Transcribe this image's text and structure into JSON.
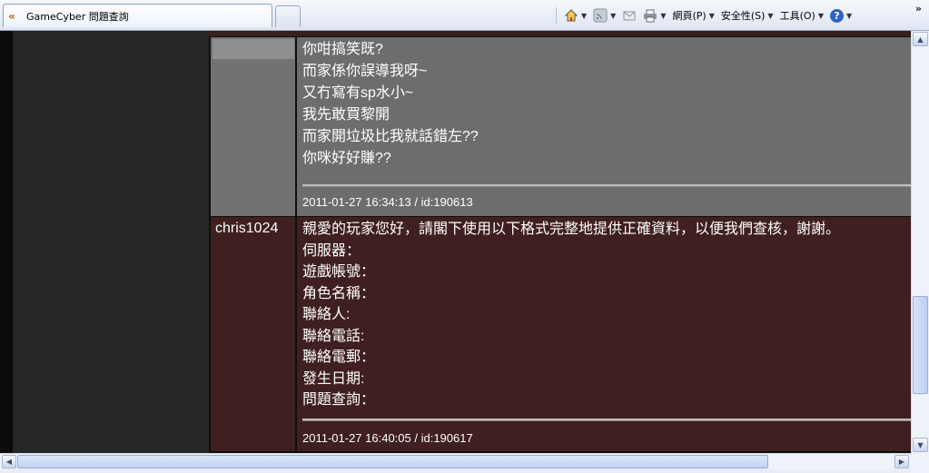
{
  "browser": {
    "tab_title": "GameCyber 問題查詢",
    "tab_icon": "back-arrows-icon",
    "commands": {
      "home_icon": "home-icon",
      "feeds_icon": "rss-feed-icon",
      "mail_icon": "mail-icon",
      "print_icon": "printer-icon",
      "page_label": "網頁(P)",
      "safety_label": "安全性(S)",
      "tools_label": "工具(O)",
      "help_icon": "help-icon",
      "overflow": "»"
    }
  },
  "posts": [
    {
      "username": "",
      "lines": [
        "你咁搞笑既?",
        "而家係你誤導我呀~",
        "又冇寫有sp水小~",
        "我先敢買黎開",
        "而家開垃圾比我就話錯左??",
        "你咪好好賺??"
      ],
      "meta": "2011-01-27 16:34:13 / id:190613"
    },
    {
      "username": "chris1024",
      "lines": [
        "親愛的玩家您好，請閣下使用以下格式完整地提供正確資料，以便我們查核，謝謝。",
        "伺服器：",
        "遊戲帳號：",
        "角色名稱：",
        "聯絡人:",
        "聯絡電話:",
        "聯絡電郵：",
        "發生日期:",
        "問題查詢："
      ],
      "meta": "2011-01-27 16:40:05 / id:190617"
    }
  ],
  "colors": {
    "post_bg_user": "#6d6d6d",
    "post_bg_staff": "#3f1f1f",
    "page_bg": "#1b1b1b"
  }
}
